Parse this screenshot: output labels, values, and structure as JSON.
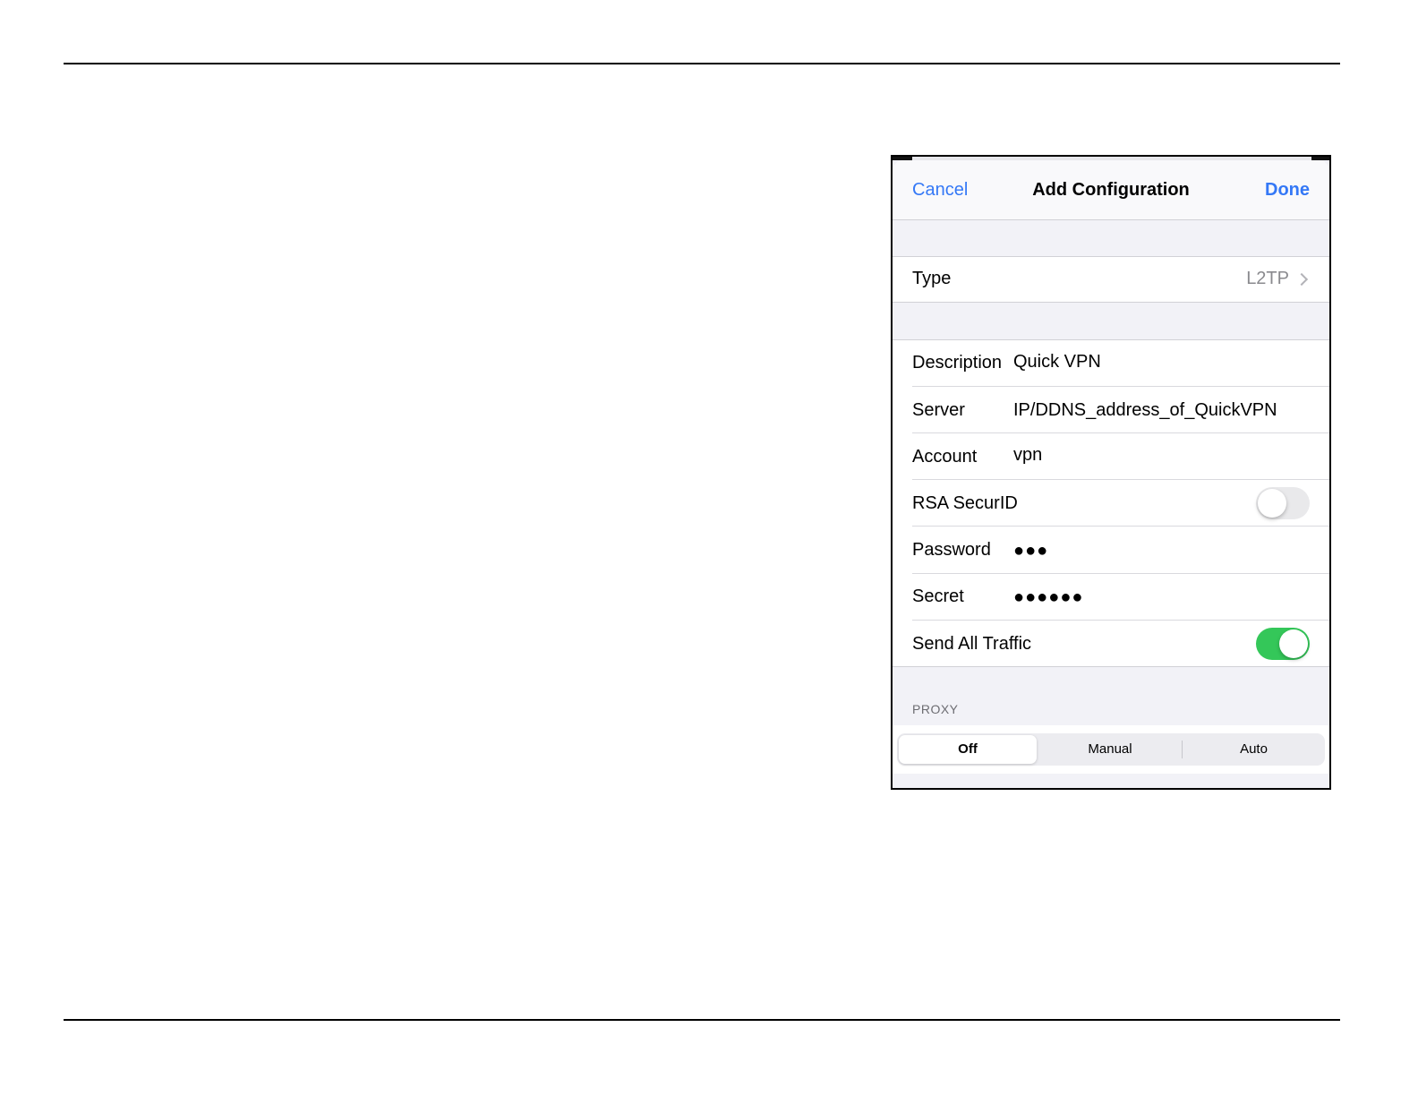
{
  "nav": {
    "cancel_label": "Cancel",
    "title": "Add Configuration",
    "done_label": "Done"
  },
  "type_row": {
    "label": "Type",
    "value": "L2TP"
  },
  "fields": {
    "description": {
      "label": "Description",
      "value": "Quick VPN"
    },
    "server": {
      "label": "Server",
      "value": "IP/DDNS_address_of_QuickVPN"
    },
    "account": {
      "label": "Account",
      "value": "vpn"
    },
    "rsa_securid": {
      "label": "RSA SecurID",
      "enabled": false
    },
    "password": {
      "label": "Password",
      "value": "●●●"
    },
    "secret": {
      "label": "Secret",
      "value": "●●●●●●"
    },
    "send_all_traffic": {
      "label": "Send All Traffic",
      "enabled": true
    }
  },
  "proxy": {
    "header": "PROXY",
    "options": [
      "Off",
      "Manual",
      "Auto"
    ],
    "selected": "Off"
  },
  "colors": {
    "accent": "#3478f6",
    "toggle_on": "#34c759",
    "toggle_off": "#e9e9eb",
    "grouped_background": "#f2f2f7"
  },
  "icons": {
    "type_chevron": "chevron-right-icon"
  }
}
